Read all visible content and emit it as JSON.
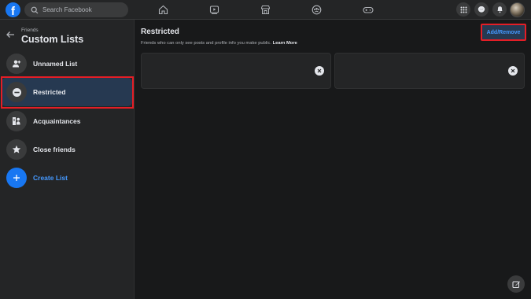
{
  "topbar": {
    "logo_letter": "f",
    "search_placeholder": "Search Facebook"
  },
  "sidebar": {
    "breadcrumb": "Friends",
    "title": "Custom Lists",
    "items": [
      {
        "label": "Unnamed List",
        "icon": "person-add-icon"
      },
      {
        "label": "Restricted",
        "icon": "minus-circle-icon"
      },
      {
        "label": "Acquaintances",
        "icon": "person-board-icon"
      },
      {
        "label": "Close friends",
        "icon": "star-icon"
      },
      {
        "label": "Create List",
        "icon": "plus-icon"
      }
    ]
  },
  "main": {
    "title": "Restricted",
    "subtitle": "Friends who can only see posts and profile info you make public.",
    "learn_more": "Learn More",
    "add_remove_label": "Add/Remove"
  },
  "colors": {
    "accent": "#1877f2",
    "link_blue": "#4599ff",
    "highlight_red": "#e41e26",
    "bg": "#18191a",
    "surface": "#242526"
  }
}
